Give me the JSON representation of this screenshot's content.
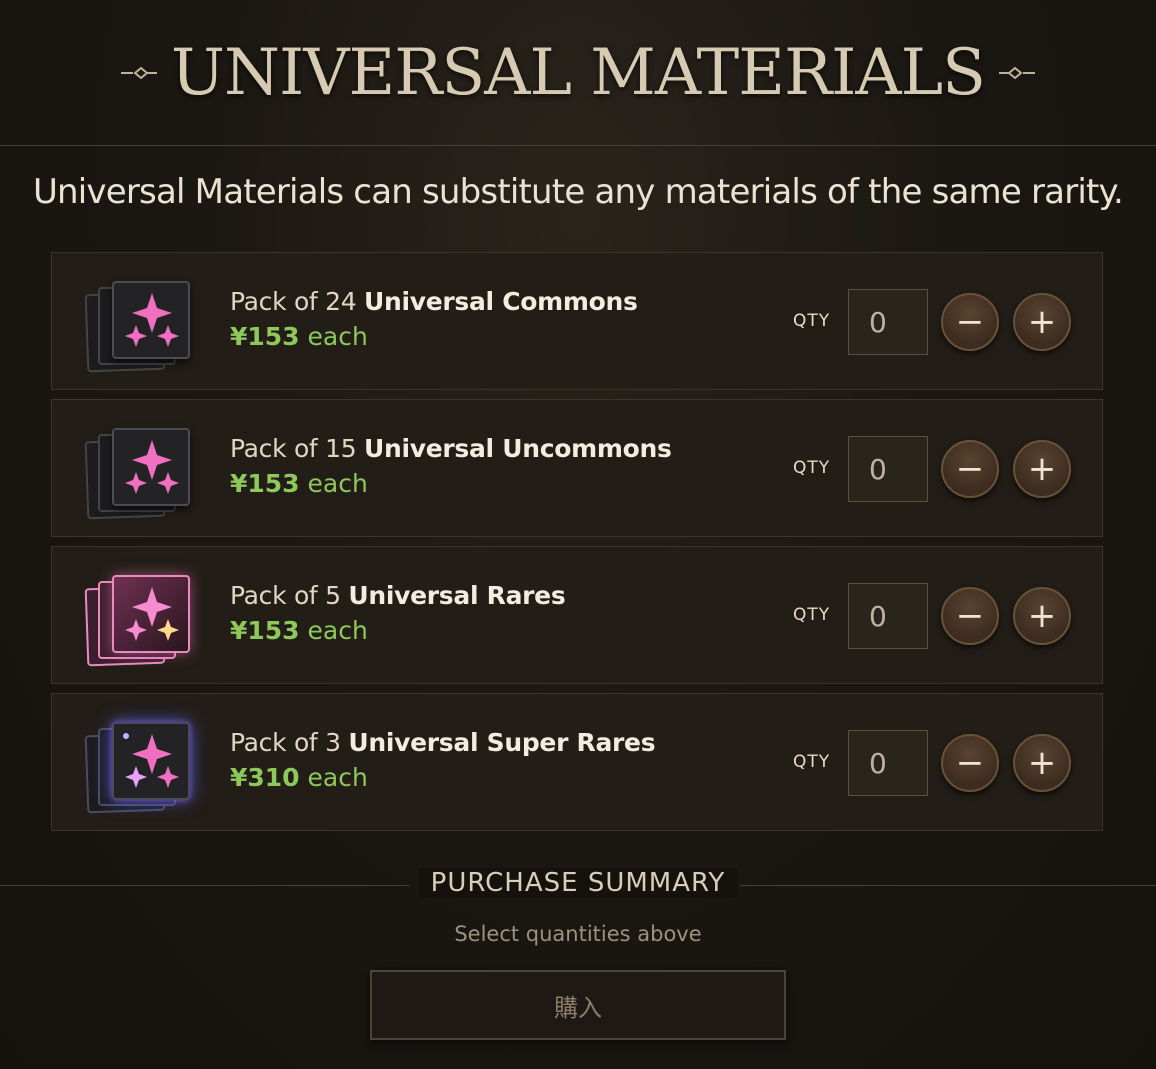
{
  "header": {
    "title": "UNIVERSAL MATERIALS"
  },
  "subtitle": "Universal Materials can substitute any materials of the same rarity.",
  "qty_label": "QTY",
  "items": [
    {
      "prefix": "Pack of 24 ",
      "name": "Universal Commons",
      "price": "¥153",
      "suffix": " each",
      "qty": "0",
      "rarity": "common",
      "icon": "sparkle-card-icon"
    },
    {
      "prefix": "Pack of 15 ",
      "name": "Universal Uncommons",
      "price": "¥153",
      "suffix": " each",
      "qty": "0",
      "rarity": "uncommon",
      "icon": "sparkle-card-icon"
    },
    {
      "prefix": "Pack of 5 ",
      "name": "Universal Rares",
      "price": "¥153",
      "suffix": " each",
      "qty": "0",
      "rarity": "rare",
      "icon": "sparkle-card-icon"
    },
    {
      "prefix": "Pack of 3 ",
      "name": "Universal Super Rares",
      "price": "¥310",
      "suffix": " each",
      "qty": "0",
      "rarity": "super-rare",
      "icon": "sparkle-card-icon"
    }
  ],
  "controls": {
    "minus_icon": "minus-icon",
    "plus_icon": "plus-icon"
  },
  "summary": {
    "title": "PURCHASE SUMMARY",
    "hint": "Select quantities above",
    "buy_label": "購入"
  },
  "colors": {
    "price": "#8ec85a",
    "accent": "#d6cab2",
    "background": "#1b1712"
  }
}
